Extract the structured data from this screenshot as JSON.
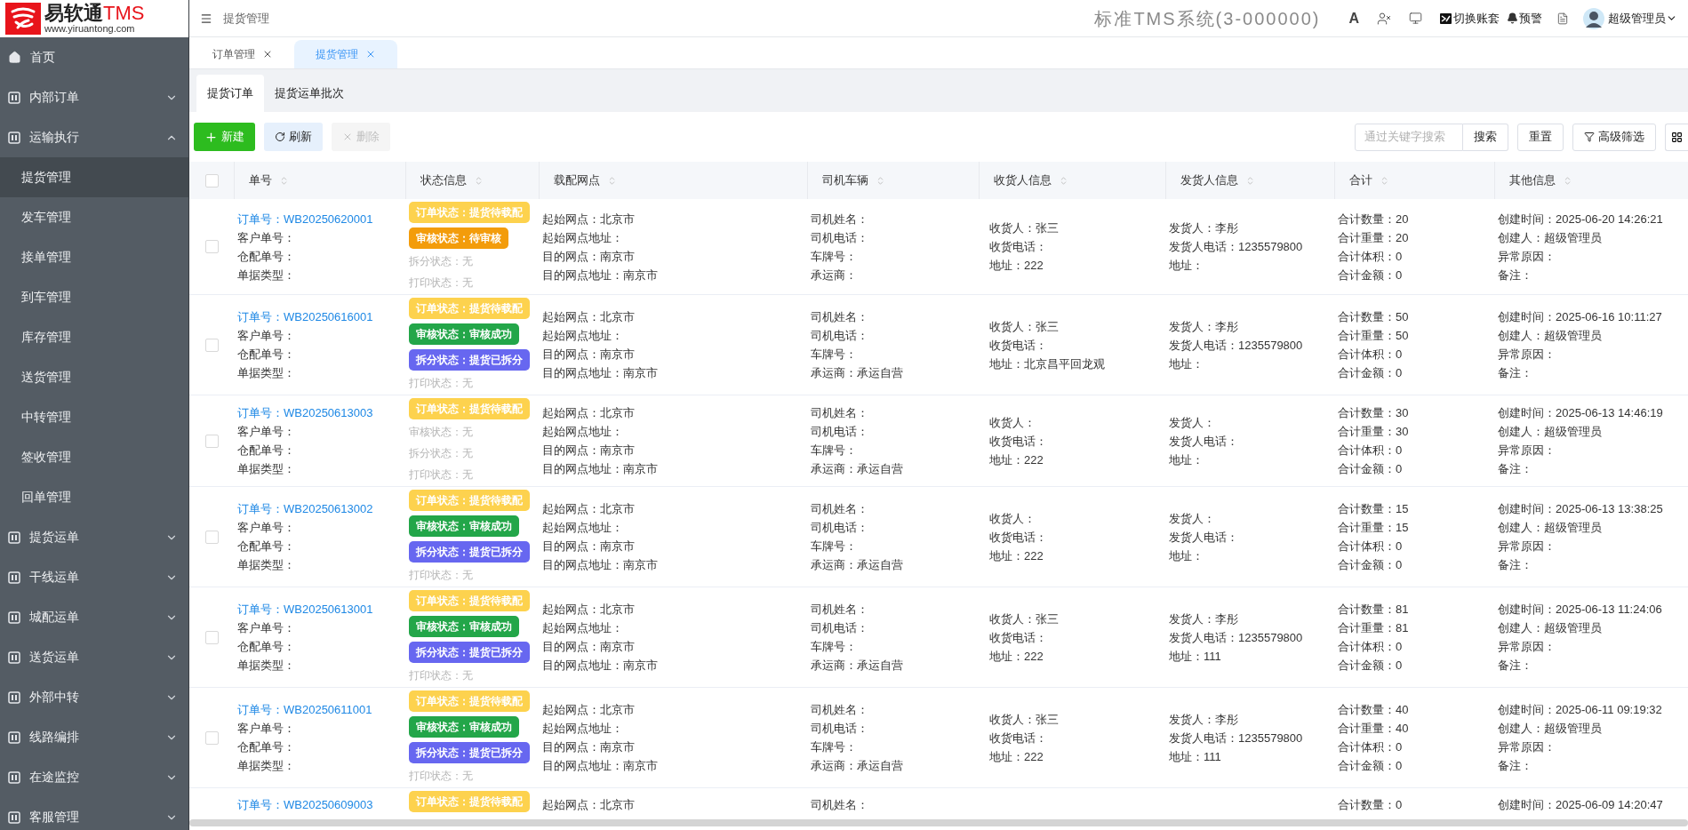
{
  "logo": {
    "name": "易软通",
    "suffix": "TMS",
    "url": "www.yiruantong.com"
  },
  "header": {
    "breadcrumb": "提货管理",
    "system_title": "标准TMS系统(3-000000)",
    "font_button": "A",
    "switch_label": "切换账套",
    "alert_label": "预警",
    "user": "超级管理员"
  },
  "sidebar": {
    "items": [
      {
        "kind": "link",
        "label": "首页"
      },
      {
        "kind": "group",
        "label": "内部订单",
        "expanded": false
      },
      {
        "kind": "group",
        "label": "运输执行",
        "expanded": true,
        "children": [
          {
            "label": "提货管理",
            "selected": true
          },
          {
            "label": "发车管理",
            "selected": false
          },
          {
            "label": "接单管理",
            "selected": false
          },
          {
            "label": "到车管理",
            "selected": false
          },
          {
            "label": "库存管理",
            "selected": false
          },
          {
            "label": "送货管理",
            "selected": false
          },
          {
            "label": "中转管理",
            "selected": false
          },
          {
            "label": "签收管理",
            "selected": false
          },
          {
            "label": "回单管理",
            "selected": false
          }
        ]
      },
      {
        "kind": "group",
        "label": "提货运单",
        "expanded": false
      },
      {
        "kind": "group",
        "label": "干线运单",
        "expanded": false
      },
      {
        "kind": "group",
        "label": "城配运单",
        "expanded": false
      },
      {
        "kind": "group",
        "label": "送货运单",
        "expanded": false
      },
      {
        "kind": "group",
        "label": "外部中转",
        "expanded": false
      },
      {
        "kind": "group",
        "label": "线路编排",
        "expanded": false
      },
      {
        "kind": "group",
        "label": "在途监控",
        "expanded": false
      },
      {
        "kind": "group",
        "label": "客服管理",
        "expanded": false
      }
    ]
  },
  "page_tabs": [
    {
      "label": "订单管理",
      "selected": false
    },
    {
      "label": "提货管理",
      "selected": true
    }
  ],
  "sub_tabs": [
    {
      "label": "提货订单",
      "selected": true
    },
    {
      "label": "提货运单批次",
      "selected": false
    }
  ],
  "toolbar": {
    "new": "新建",
    "refresh": "刷新",
    "delete": {
      "label": "删除",
      "disabled": true
    },
    "search_placeholder": "通过关键字搜索",
    "search": "搜索",
    "reset": "重置",
    "filter": "高级筛选"
  },
  "table": {
    "select_all": {
      "checked": false
    },
    "columns": [
      "单号",
      "状态信息",
      "载配网点",
      "司机车辆",
      "收货人信息",
      "发货人信息",
      "合计",
      "其他信息"
    ],
    "rows": [
      {
        "checked": false,
        "order_no": "订单号：WB20250620001",
        "order_fields": [
          "客户单号：",
          "仓配单号：",
          "单据类型："
        ],
        "statuses": [
          {
            "kind": "tag",
            "text": "订单状态：提货待载配",
            "color": "#fdd24e"
          },
          {
            "kind": "tag",
            "text": "审核状态：待审核",
            "color": "#f39c0b"
          },
          {
            "kind": "text",
            "text": "拆分状态：无"
          },
          {
            "kind": "text",
            "text": "打印状态：无"
          }
        ],
        "network": [
          "起始网点：北京市",
          "起始网点地址：",
          "目的网点：南京市",
          "目的网点地址：南京市"
        ],
        "driver": [
          "司机姓名：",
          "司机电话：",
          "车牌号：",
          "承运商："
        ],
        "consignee": [
          "收货人：张三",
          "收货电话：",
          "地址：222"
        ],
        "shipper": [
          "发货人：李彤",
          "发货人电话：1235579800",
          "地址："
        ],
        "totals": [
          "合计数量：20",
          "合计重量：20",
          "合计体积：0",
          "合计金额：0"
        ],
        "other": [
          "创建时间：2025-06-20 14:26:21",
          "创建人：超级管理员",
          "异常原因：",
          "备注："
        ]
      },
      {
        "checked": false,
        "order_no": "订单号：WB20250616001",
        "order_fields": [
          "客户单号：",
          "仓配单号：",
          "单据类型："
        ],
        "statuses": [
          {
            "kind": "tag",
            "text": "订单状态：提货待载配",
            "color": "#fdd24e"
          },
          {
            "kind": "tag",
            "text": "审核状态：审核成功",
            "color": "#23a649"
          },
          {
            "kind": "tag",
            "text": "拆分状态：提货已拆分",
            "color": "#6767f0"
          },
          {
            "kind": "text",
            "text": "打印状态：无"
          }
        ],
        "network": [
          "起始网点：北京市",
          "起始网点地址：",
          "目的网点：南京市",
          "目的网点地址：南京市"
        ],
        "driver": [
          "司机姓名：",
          "司机电话：",
          "车牌号：",
          "承运商：承运自营"
        ],
        "consignee": [
          "收货人：张三",
          "收货电话：",
          "地址：北京昌平回龙观"
        ],
        "shipper": [
          "发货人：李彤",
          "发货人电话：1235579800",
          "地址："
        ],
        "totals": [
          "合计数量：50",
          "合计重量：50",
          "合计体积：0",
          "合计金额：0"
        ],
        "other": [
          "创建时间：2025-06-16 10:11:27",
          "创建人：超级管理员",
          "异常原因：",
          "备注："
        ]
      },
      {
        "checked": false,
        "order_no": "订单号：WB20250613003",
        "order_fields": [
          "客户单号：",
          "仓配单号：",
          "单据类型："
        ],
        "statuses": [
          {
            "kind": "tag",
            "text": "订单状态：提货待载配",
            "color": "#fdd24e"
          },
          {
            "kind": "text",
            "text": "审核状态：无"
          },
          {
            "kind": "text",
            "text": "拆分状态：无"
          },
          {
            "kind": "text",
            "text": "打印状态：无"
          }
        ],
        "network": [
          "起始网点：北京市",
          "起始网点地址：",
          "目的网点：南京市",
          "目的网点地址：南京市"
        ],
        "driver": [
          "司机姓名：",
          "司机电话：",
          "车牌号：",
          "承运商：承运自营"
        ],
        "consignee": [
          "收货人：",
          "收货电话：",
          "地址：222"
        ],
        "shipper": [
          "发货人：",
          "发货人电话：",
          "地址："
        ],
        "totals": [
          "合计数量：30",
          "合计重量：30",
          "合计体积：0",
          "合计金额：0"
        ],
        "other": [
          "创建时间：2025-06-13 14:46:19",
          "创建人：超级管理员",
          "异常原因：",
          "备注："
        ]
      },
      {
        "checked": false,
        "order_no": "订单号：WB20250613002",
        "order_fields": [
          "客户单号：",
          "仓配单号：",
          "单据类型："
        ],
        "statuses": [
          {
            "kind": "tag",
            "text": "订单状态：提货待载配",
            "color": "#fdd24e"
          },
          {
            "kind": "tag",
            "text": "审核状态：审核成功",
            "color": "#23a649"
          },
          {
            "kind": "tag",
            "text": "拆分状态：提货已拆分",
            "color": "#6767f0"
          },
          {
            "kind": "text",
            "text": "打印状态：无"
          }
        ],
        "network": [
          "起始网点：北京市",
          "起始网点地址：",
          "目的网点：南京市",
          "目的网点地址：南京市"
        ],
        "driver": [
          "司机姓名：",
          "司机电话：",
          "车牌号：",
          "承运商：承运自营"
        ],
        "consignee": [
          "收货人：",
          "收货电话：",
          "地址：222"
        ],
        "shipper": [
          "发货人：",
          "发货人电话：",
          "地址："
        ],
        "totals": [
          "合计数量：15",
          "合计重量：15",
          "合计体积：0",
          "合计金额：0"
        ],
        "other": [
          "创建时间：2025-06-13 13:38:25",
          "创建人：超级管理员",
          "异常原因：",
          "备注："
        ]
      },
      {
        "checked": false,
        "order_no": "订单号：WB20250613001",
        "order_fields": [
          "客户单号：",
          "仓配单号：",
          "单据类型："
        ],
        "statuses": [
          {
            "kind": "tag",
            "text": "订单状态：提货待载配",
            "color": "#fdd24e"
          },
          {
            "kind": "tag",
            "text": "审核状态：审核成功",
            "color": "#23a649"
          },
          {
            "kind": "tag",
            "text": "拆分状态：提货已拆分",
            "color": "#6767f0"
          },
          {
            "kind": "text",
            "text": "打印状态：无"
          }
        ],
        "network": [
          "起始网点：北京市",
          "起始网点地址：",
          "目的网点：南京市",
          "目的网点地址：南京市"
        ],
        "driver": [
          "司机姓名：",
          "司机电话：",
          "车牌号：",
          "承运商：承运自营"
        ],
        "consignee": [
          "收货人：张三",
          "收货电话：",
          "地址：222"
        ],
        "shipper": [
          "发货人：李彤",
          "发货人电话：1235579800",
          "地址：111"
        ],
        "totals": [
          "合计数量：81",
          "合计重量：81",
          "合计体积：0",
          "合计金额：0"
        ],
        "other": [
          "创建时间：2025-06-13 11:24:06",
          "创建人：超级管理员",
          "异常原因：",
          "备注："
        ]
      },
      {
        "checked": false,
        "order_no": "订单号：WB20250611001",
        "order_fields": [
          "客户单号：",
          "仓配单号：",
          "单据类型："
        ],
        "statuses": [
          {
            "kind": "tag",
            "text": "订单状态：提货待载配",
            "color": "#fdd24e"
          },
          {
            "kind": "tag",
            "text": "审核状态：审核成功",
            "color": "#23a649"
          },
          {
            "kind": "tag",
            "text": "拆分状态：提货已拆分",
            "color": "#6767f0"
          },
          {
            "kind": "text",
            "text": "打印状态：无"
          }
        ],
        "network": [
          "起始网点：北京市",
          "起始网点地址：",
          "目的网点：南京市",
          "目的网点地址：南京市"
        ],
        "driver": [
          "司机姓名：",
          "司机电话：",
          "车牌号：",
          "承运商：承运自营"
        ],
        "consignee": [
          "收货人：张三",
          "收货电话：",
          "地址：222"
        ],
        "shipper": [
          "发货人：李彤",
          "发货人电话：1235579800",
          "地址：111"
        ],
        "totals": [
          "合计数量：40",
          "合计重量：40",
          "合计体积：0",
          "合计金额：0"
        ],
        "other": [
          "创建时间：2025-06-11 09:19:32",
          "创建人：超级管理员",
          "异常原因：",
          "备注："
        ]
      },
      {
        "order_no": "订单号：WB20250609003",
        "order_fields": [],
        "statuses": [
          {
            "kind": "tag",
            "text": "订单状态：提货待载配",
            "color": "#fdd24e"
          }
        ],
        "network": [
          "起始网点：北京市"
        ],
        "driver": [
          "司机姓名："
        ],
        "consignee": [],
        "shipper": [],
        "totals": [
          "合计数量：0"
        ],
        "other": [
          "创建时间：2025-06-09 14:20:47"
        ]
      }
    ]
  }
}
